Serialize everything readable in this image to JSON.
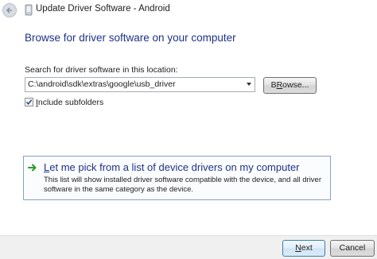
{
  "window": {
    "title": "Update Driver Software - Android"
  },
  "main": {
    "heading": "Browse for driver software on your computer",
    "location_label_pre": "Search for driver software in this location:",
    "path_value": "C:\\android\\sdk\\extras\\google\\usb_driver",
    "browse_label_underlined": "R",
    "browse_label_pre": "B",
    "browse_label_post": "owse...",
    "include_sub_pre": "",
    "include_sub_underlined": "I",
    "include_sub_post": "nclude subfolders",
    "include_sub_checked": true
  },
  "pick": {
    "title_pre": "",
    "title_underlined": "L",
    "title_post": "et me pick from a list of device drivers on my computer",
    "description": "This list will show installed driver software compatible with the device, and all driver software in the same category as the device."
  },
  "footer": {
    "next_underlined": "N",
    "next_post": "ext",
    "cancel_label": "Cancel"
  }
}
